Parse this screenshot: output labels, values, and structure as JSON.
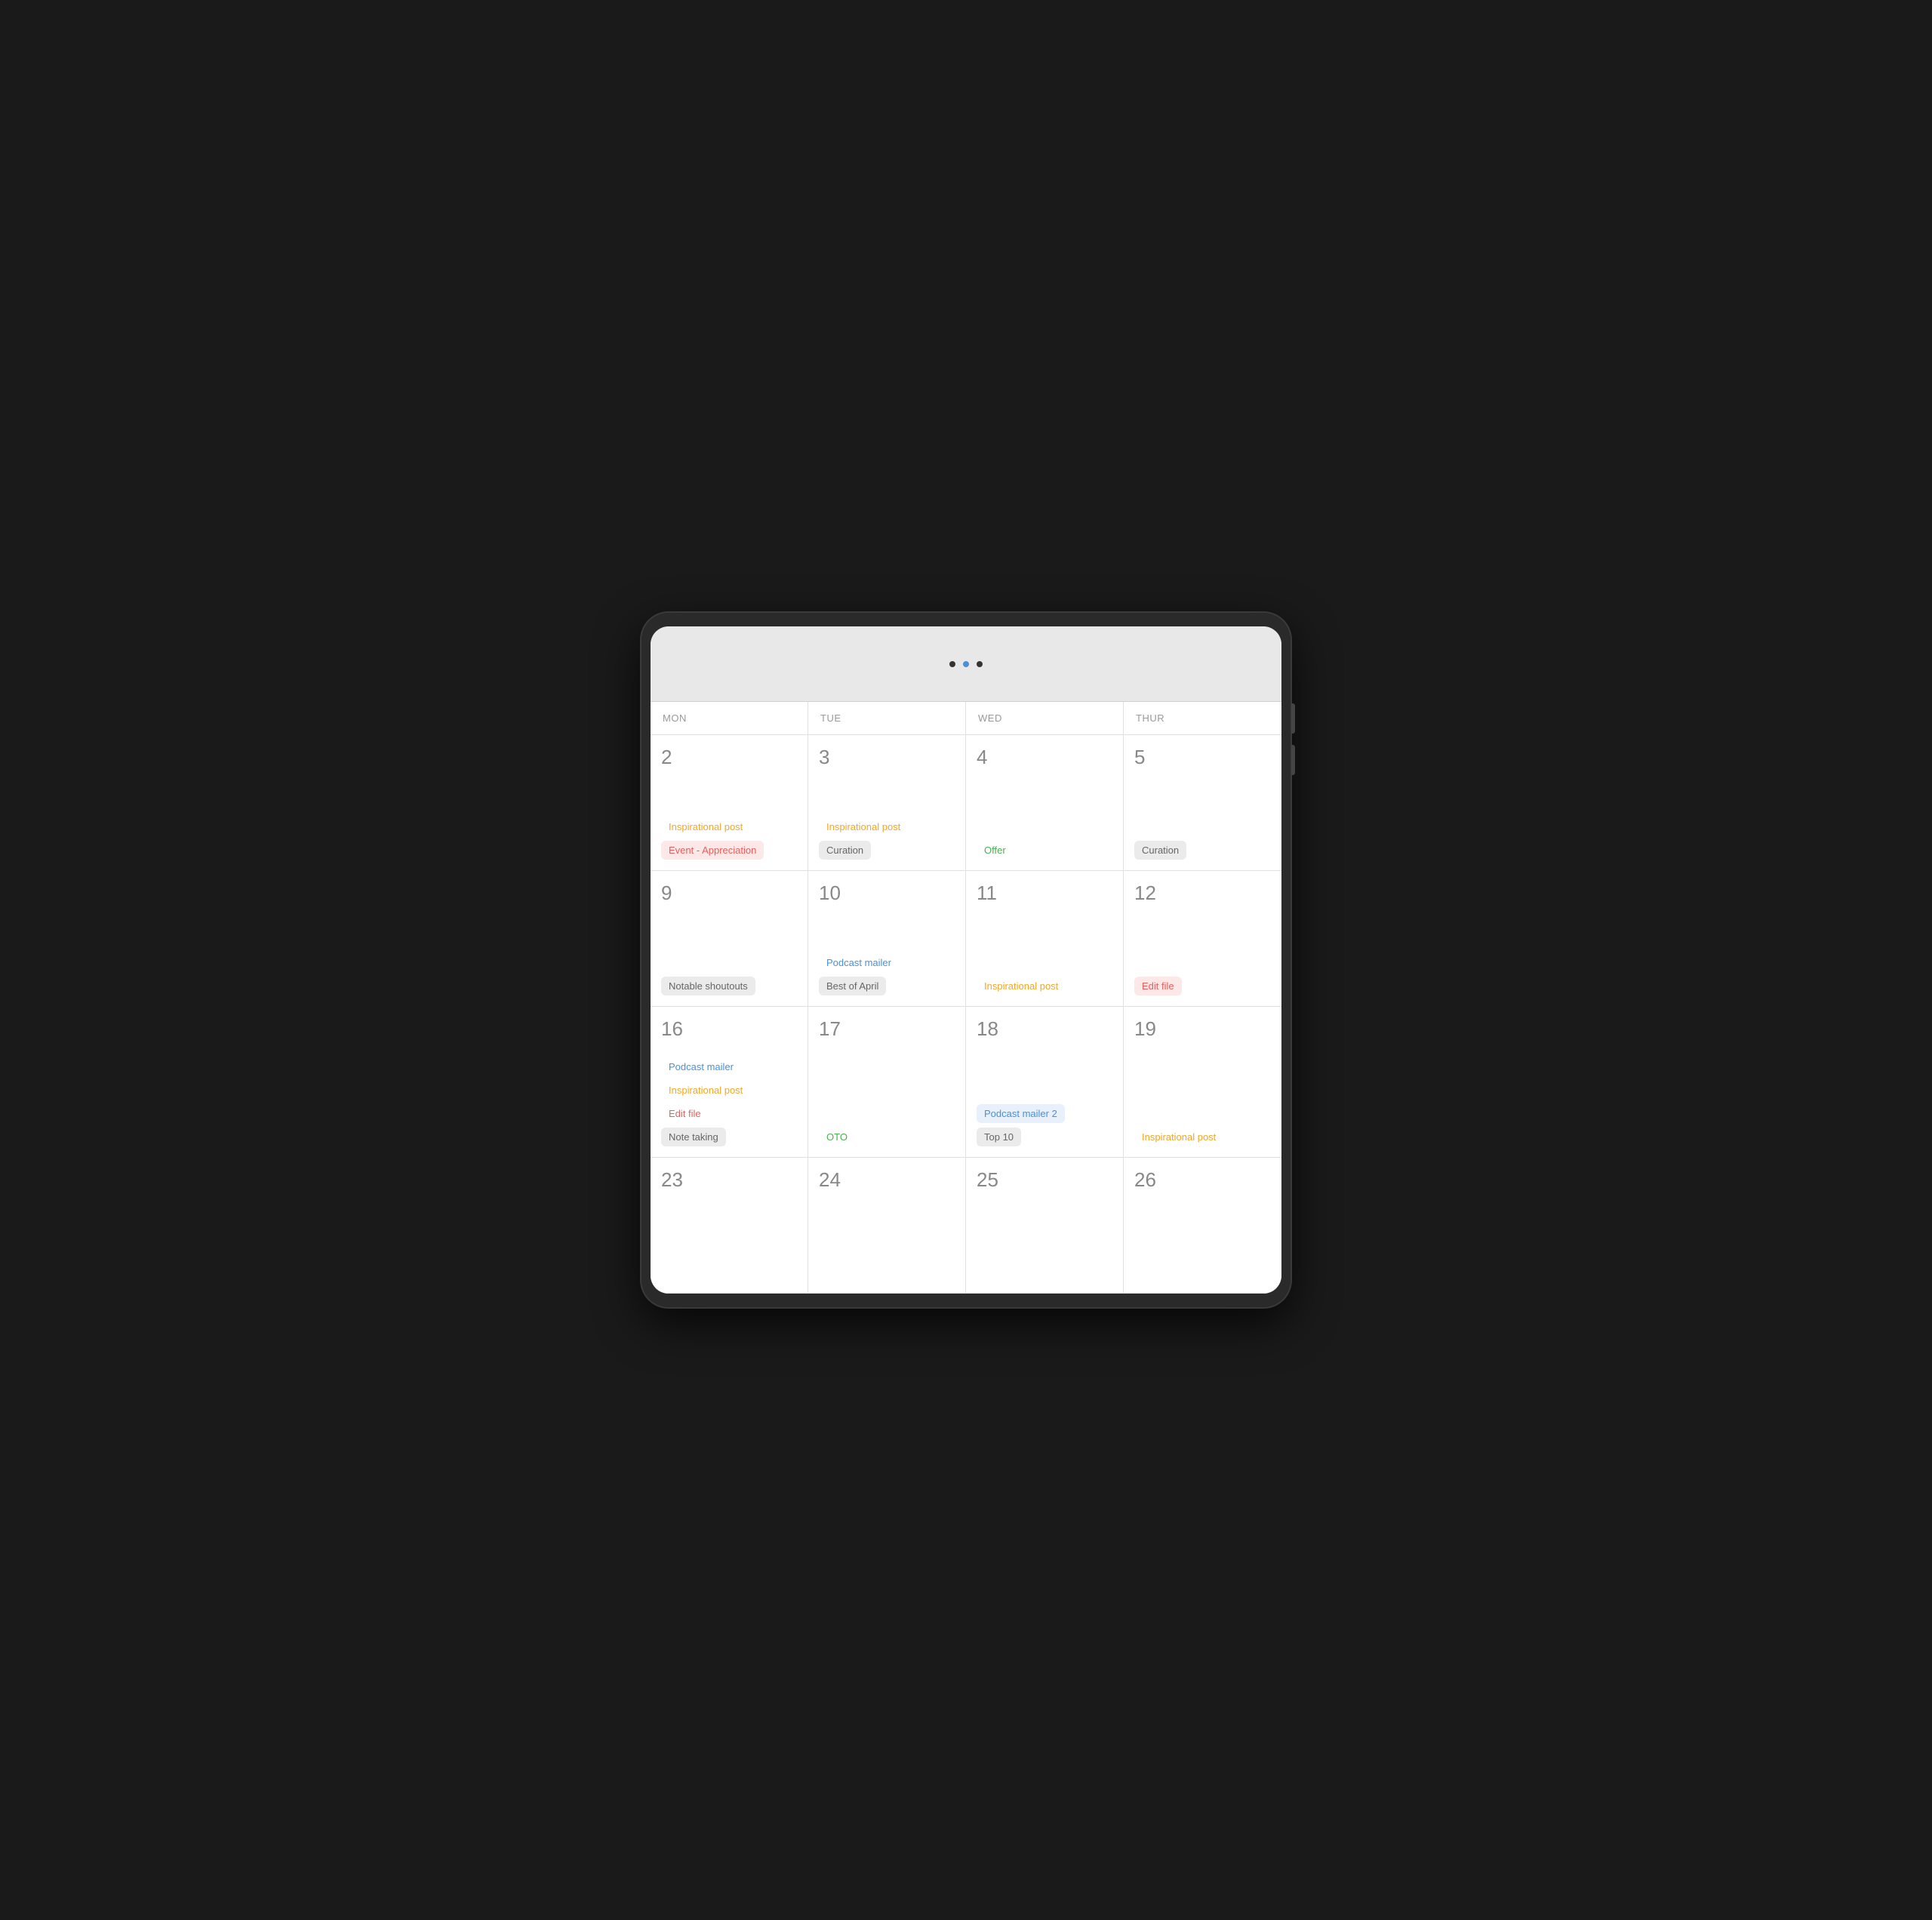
{
  "header": {
    "columns": [
      "MON",
      "TUE",
      "WED",
      "THUR"
    ]
  },
  "weeks": [
    {
      "days": [
        {
          "number": "2",
          "events": [
            {
              "label": "Inspirational post",
              "style": "tag-orange"
            },
            {
              "label": "Event - Appreciation",
              "style": "tag-red"
            }
          ]
        },
        {
          "number": "3",
          "events": [
            {
              "label": "Inspirational post",
              "style": "tag-orange"
            },
            {
              "label": "Curation",
              "style": "tag-gray"
            }
          ]
        },
        {
          "number": "4",
          "events": [
            {
              "label": "Offer",
              "style": "tag-green"
            }
          ]
        },
        {
          "number": "5",
          "events": [
            {
              "label": "Curation",
              "style": "tag-gray"
            }
          ]
        }
      ]
    },
    {
      "days": [
        {
          "number": "9",
          "events": [
            {
              "label": "Notable shoutouts",
              "style": "tag-gray"
            }
          ]
        },
        {
          "number": "10",
          "events": [
            {
              "label": "Podcast mailer",
              "style": "tag-blue"
            },
            {
              "label": "Best of April",
              "style": "tag-gray"
            }
          ]
        },
        {
          "number": "11",
          "events": [
            {
              "label": "Inspirational post",
              "style": "tag-orange"
            }
          ]
        },
        {
          "number": "12",
          "events": [
            {
              "label": "Edit file",
              "style": "tag-red"
            }
          ]
        }
      ]
    },
    {
      "days": [
        {
          "number": "16",
          "events": [
            {
              "label": "Podcast mailer",
              "style": "tag-blue"
            },
            {
              "label": "Inspirational post",
              "style": "tag-orange"
            },
            {
              "label": "Edit file",
              "style": "tag-red-text"
            },
            {
              "label": "Note taking",
              "style": "tag-gray"
            }
          ]
        },
        {
          "number": "17",
          "events": [
            {
              "label": "OTO",
              "style": "tag-green-text"
            }
          ]
        },
        {
          "number": "18",
          "events": [
            {
              "label": "Podcast mailer 2",
              "style": "tag-blue-bg"
            },
            {
              "label": "Top 10",
              "style": "tag-gray"
            }
          ]
        },
        {
          "number": "19",
          "events": [
            {
              "label": "Inspirational post",
              "style": "tag-orange"
            }
          ]
        }
      ]
    },
    {
      "days": [
        {
          "number": "23",
          "events": []
        },
        {
          "number": "24",
          "events": []
        },
        {
          "number": "25",
          "events": []
        },
        {
          "number": "26",
          "events": []
        }
      ]
    }
  ]
}
